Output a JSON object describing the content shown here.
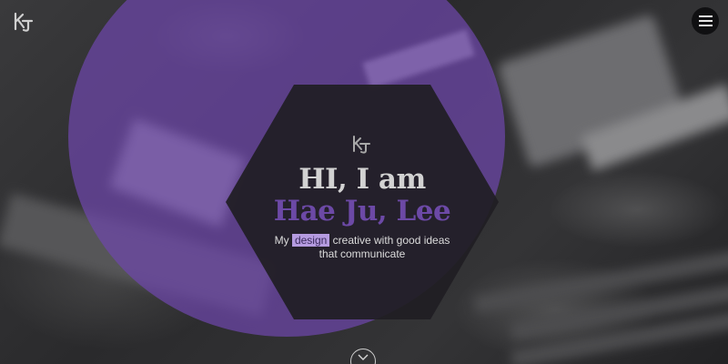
{
  "header": {
    "logo_icon": "kj-monogram-icon",
    "menu_icon": "hamburger-menu-icon"
  },
  "hero": {
    "logo_icon": "kj-monogram-icon",
    "greeting": "HI, I am",
    "name": "Hae Ju, Lee",
    "tagline_before": "My ",
    "tagline_highlight": "design",
    "tagline_after": " creative with good ideas that communicate",
    "scroll_icon": "chevron-down-icon"
  },
  "colors": {
    "accent_purple": "#6c49a6",
    "circle_overlay": "#6e46aa",
    "highlight_bg": "#b59be0",
    "hexagon_bg": "#201e24",
    "heading_gray": "#d2d2d2"
  }
}
